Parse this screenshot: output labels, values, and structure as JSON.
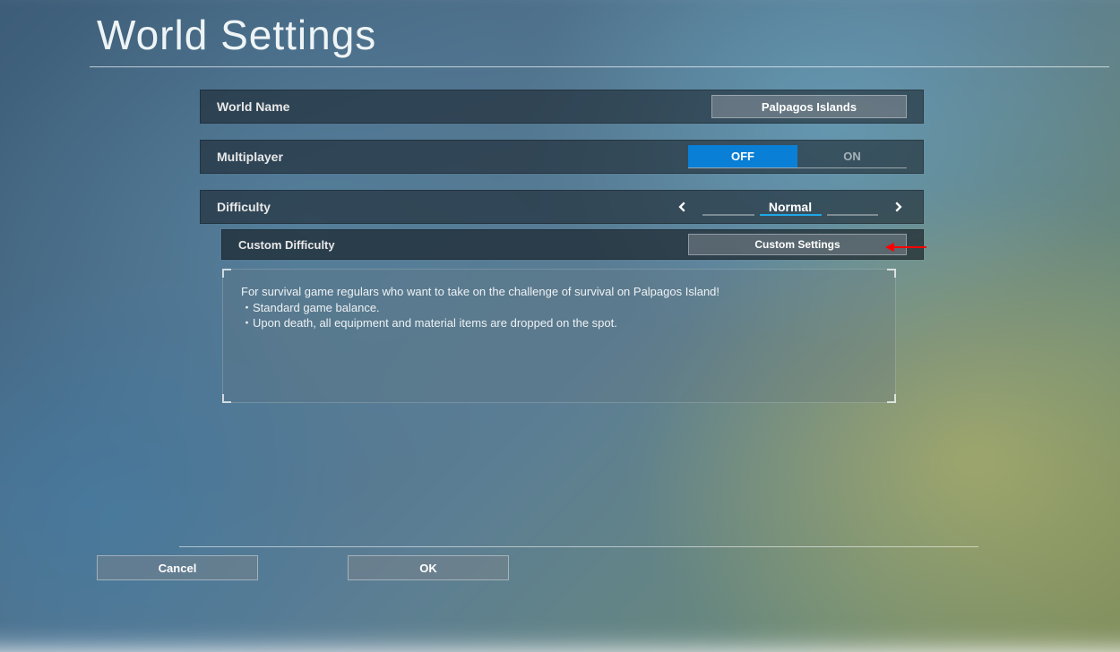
{
  "header": {
    "title": "World Settings"
  },
  "rows": {
    "world_name": {
      "label": "World Name",
      "value": "Palpagos Islands"
    },
    "multiplayer": {
      "label": "Multiplayer",
      "options": {
        "off": "OFF",
        "on": "ON"
      },
      "selected": "OFF"
    },
    "difficulty": {
      "label": "Difficulty",
      "value": "Normal"
    },
    "custom_difficulty": {
      "label": "Custom Difficulty",
      "button": "Custom Settings"
    }
  },
  "description": {
    "line1": "For survival game regulars who want to take on the challenge of survival on Palpagos Island!",
    "line2": "・Standard game balance.",
    "line3": "・Upon death, all equipment and material items are dropped on the spot."
  },
  "footer": {
    "cancel": "Cancel",
    "ok": "OK"
  }
}
